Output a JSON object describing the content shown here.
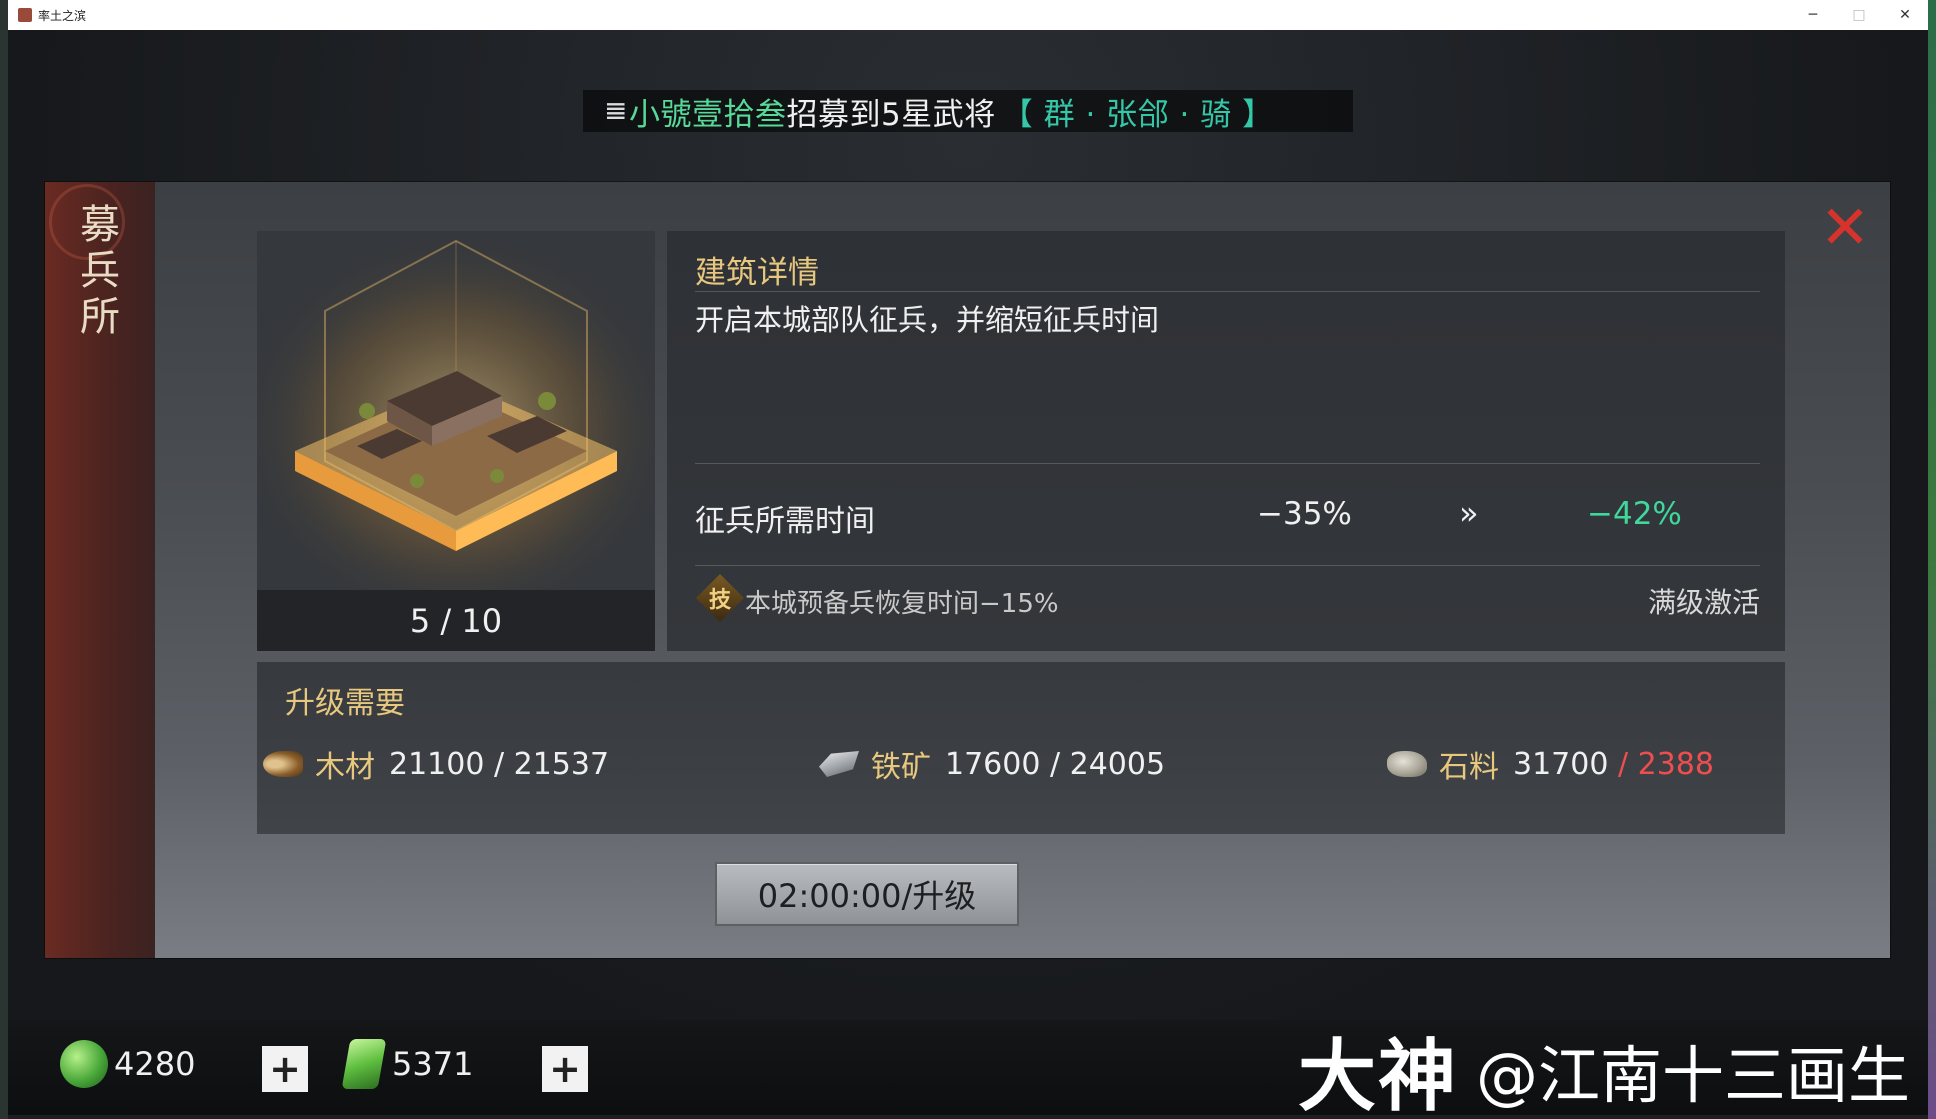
{
  "window": {
    "title": "率土之滨",
    "minimize": "─",
    "maximize": "□",
    "close": "✕"
  },
  "notice": {
    "speaker": "𝌆",
    "player": "小號壹拾叁",
    "message": "招募到5星武将",
    "general": "【 群 · 张郃 · 骑 】"
  },
  "panel": {
    "side_title_1": "募",
    "side_title_2": "兵",
    "side_title_3": "所",
    "close": "✕",
    "level": "5 / 10",
    "details_title": "建筑详情",
    "description": "开启本城部队征兵，并缩短征兵时间",
    "stat": {
      "label": "征兵所需时间",
      "current": "−35%",
      "arrow": "»",
      "next": "−42%"
    },
    "skill": {
      "icon_char": "技",
      "text": "本城预备兵恢复时间−15%",
      "status": "满级激活"
    },
    "requirements": {
      "title": "升级需要",
      "wood": {
        "name": "木材",
        "have": "21100",
        "sep": " / ",
        "need": "21537",
        "icon": "wood-icon"
      },
      "iron": {
        "name": "铁矿",
        "have": "17600",
        "sep": " / ",
        "need": "24005",
        "icon": "iron-icon"
      },
      "stone": {
        "name": "石料",
        "have": "31700",
        "sep": " / ",
        "need": "2388",
        "icon": "stone-icon"
      }
    },
    "upgrade_button": "02:00:00/升级"
  },
  "bottom": {
    "jade": "4280",
    "token": "5371",
    "plus": "+",
    "watermark_logo": "大神",
    "watermark_author": "@江南十三画生"
  },
  "colors": {
    "gold_heading": "#e8c87f",
    "green_value": "#3fd79c",
    "red_shortfall": "#ee4e4e",
    "close_red": "#d5332b"
  }
}
